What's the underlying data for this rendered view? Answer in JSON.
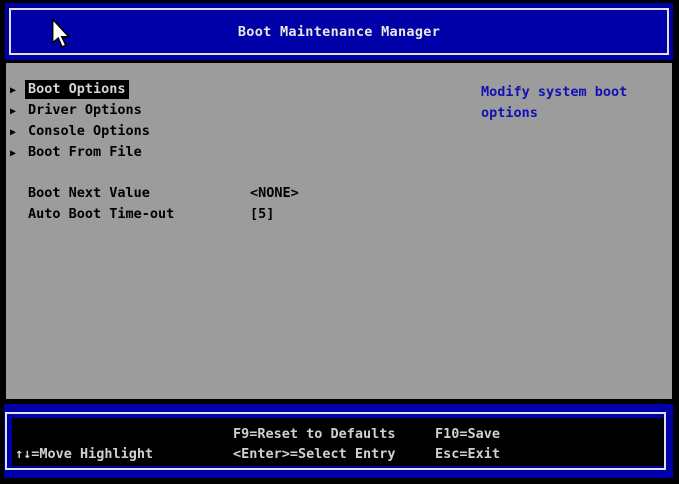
{
  "titlebar": {
    "title": "Boot Maintenance Manager"
  },
  "menu": {
    "arrow_icon": "▶",
    "items": [
      {
        "label": "Boot Options",
        "selected": true
      },
      {
        "label": "Driver Options",
        "selected": false
      },
      {
        "label": "Console Options",
        "selected": false
      },
      {
        "label": "Boot From File",
        "selected": false
      }
    ],
    "fields": [
      {
        "label": "Boot Next Value",
        "value": "<NONE>"
      },
      {
        "label": "Auto Boot Time-out",
        "value": "[5]"
      }
    ]
  },
  "help": {
    "text": "Modify system boot options"
  },
  "footer": {
    "move_highlight": "↑↓=Move Highlight",
    "reset_defaults": "F9=Reset to Defaults",
    "select_entry": "<Enter>=Select Entry",
    "save": "F10=Save",
    "exit": "Esc=Exit"
  },
  "colors": {
    "panel_blue": "#0000a8",
    "content_gray": "#9c9c9c",
    "help_text_blue": "#1010b4",
    "highlight_bg": "#000000",
    "highlight_text": "#d4d4d4",
    "footer_text": "#d0d0d0",
    "border_white": "#e2e2e2",
    "background_black": "#000000"
  }
}
